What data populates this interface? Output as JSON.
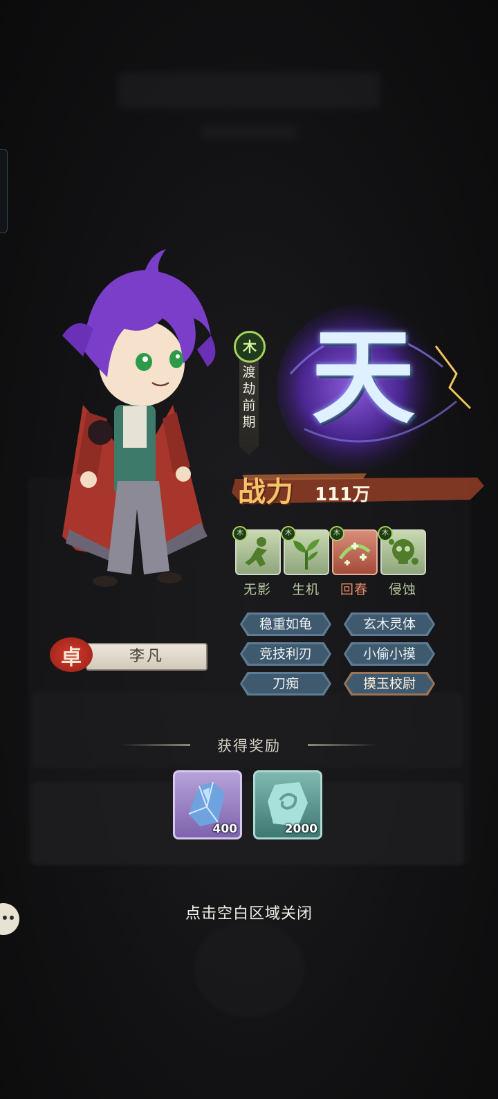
{
  "character": {
    "name": "李凡",
    "seal_char": "卓",
    "element": "木",
    "realm": "渡劫前期",
    "tier": "天",
    "power_label": "战力",
    "power_value": "111万"
  },
  "skills": [
    {
      "label": "无影",
      "element": "木",
      "icon": "shadow-figure-icon",
      "highlight": false
    },
    {
      "label": "生机",
      "element": "木",
      "icon": "sprout-icon",
      "highlight": false
    },
    {
      "label": "回春",
      "element": "木",
      "icon": "heal-plus-icon",
      "highlight": true
    },
    {
      "label": "侵蚀",
      "element": "木",
      "icon": "corrosion-skull-icon",
      "highlight": false
    }
  ],
  "traits": [
    {
      "label": "稳重如龟",
      "style": "blue"
    },
    {
      "label": "玄木灵体",
      "style": "blue"
    },
    {
      "label": "竞技利刃",
      "style": "blue"
    },
    {
      "label": "小偷小摸",
      "style": "blue"
    },
    {
      "label": "刀痴",
      "style": "blue"
    },
    {
      "label": "摸玉校尉",
      "style": "gold"
    }
  ],
  "reward": {
    "title": "获得奖励",
    "items": [
      {
        "icon": "blue-crystal-icon",
        "count": "400"
      },
      {
        "icon": "jade-stone-icon",
        "count": "2000"
      }
    ]
  },
  "close_hint": "点击空白区域关闭",
  "colors": {
    "element_green": "#a8d35a",
    "skill_highlight": "#a44b3a",
    "trait_blue": "#3f5a6e",
    "trait_gold": "#9a7558",
    "tier_purple": "#6a3fb0"
  }
}
